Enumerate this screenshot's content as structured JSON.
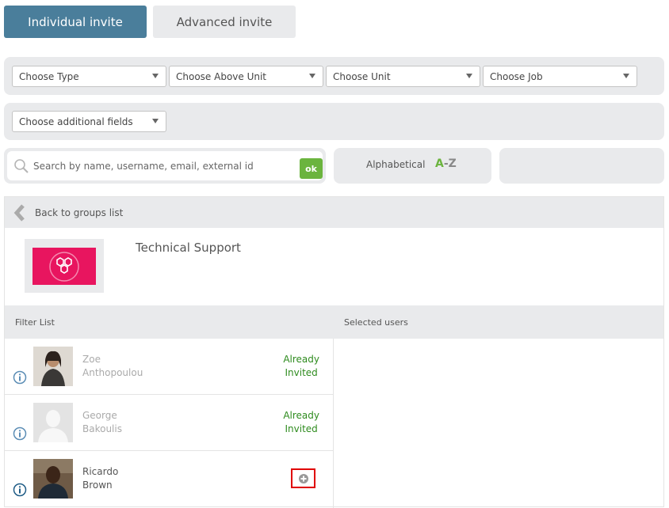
{
  "tabs": {
    "individual": "Individual invite",
    "advanced": "Advanced invite"
  },
  "filters": {
    "type": "Choose Type",
    "above_unit": "Choose Above Unit",
    "unit": "Choose Unit",
    "job": "Choose Job",
    "additional": "Choose additional fields"
  },
  "search": {
    "placeholder": "Search by name, username, email, external id",
    "ok_label": "ok"
  },
  "sort": {
    "label": "Alphabetical",
    "a": "A",
    "dash_z": "-Z"
  },
  "group": {
    "back_label": "Back to groups list",
    "title": "Technical Support"
  },
  "list": {
    "filter_header": "Filter List",
    "selected_header": "Selected users",
    "users": [
      {
        "first": "Zoe",
        "last": "Anthopoulou",
        "status_line1": "Already",
        "status_line2": "Invited"
      },
      {
        "first": "George",
        "last": "Bakoulis",
        "status_line1": "Already",
        "status_line2": "Invited"
      },
      {
        "first": "Ricardo",
        "last": "Brown",
        "status_line1": "",
        "status_line2": ""
      }
    ]
  },
  "colors": {
    "accent": "#4a7e9b",
    "ok_green": "#6bb43e",
    "invited_green": "#2e8b1e",
    "logo_pink": "#e8155f",
    "highlight_red": "#e00000"
  }
}
